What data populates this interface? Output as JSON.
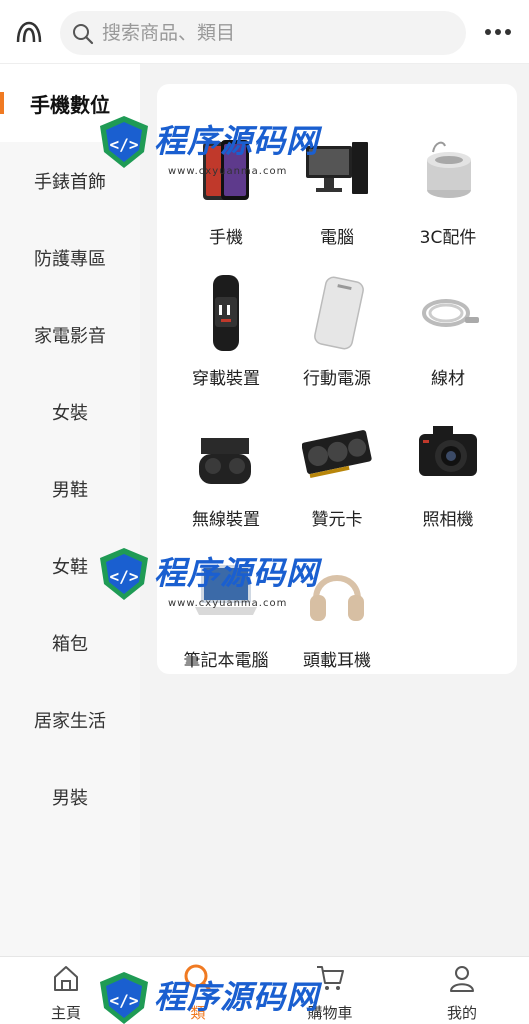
{
  "header": {
    "search_placeholder": "搜索商品、類目"
  },
  "sidebar": {
    "items": [
      {
        "label": "手機數位",
        "active": true
      },
      {
        "label": "手錶首飾"
      },
      {
        "label": "防護專區"
      },
      {
        "label": "家電影音"
      },
      {
        "label": "女裝"
      },
      {
        "label": "男鞋"
      },
      {
        "label": "女鞋"
      },
      {
        "label": "箱包"
      },
      {
        "label": "居家生活"
      },
      {
        "label": "男裝"
      }
    ]
  },
  "categories": [
    {
      "label": "手機",
      "icon": "smartphone-icon"
    },
    {
      "label": "電腦",
      "icon": "desktop-computer-icon"
    },
    {
      "label": "3C配件",
      "icon": "speaker-accessory-icon"
    },
    {
      "label": "穿載裝置",
      "icon": "smart-band-icon"
    },
    {
      "label": "行動電源",
      "icon": "power-bank-icon"
    },
    {
      "label": "線材",
      "icon": "cable-icon"
    },
    {
      "label": "無線裝置",
      "icon": "wireless-earbuds-icon"
    },
    {
      "label": "贊元卡",
      "icon": "graphics-card-icon"
    },
    {
      "label": "照相機",
      "icon": "camera-icon"
    },
    {
      "label": "筆記本電腦",
      "icon": "laptop-icon"
    },
    {
      "label": "頭載耳機",
      "icon": "headphones-icon"
    }
  ],
  "tabbar": {
    "items": [
      {
        "label": "主頁",
        "icon": "home-icon"
      },
      {
        "label": "類",
        "icon": "search-icon",
        "active": true
      },
      {
        "label": "購物車",
        "icon": "cart-icon"
      },
      {
        "label": "我的",
        "icon": "user-icon"
      }
    ]
  },
  "watermark": {
    "text": "程序源码网",
    "url": "www.cxyuanma.com"
  },
  "colors": {
    "accent": "#f07a22",
    "watermark": "#1a5fd0"
  }
}
